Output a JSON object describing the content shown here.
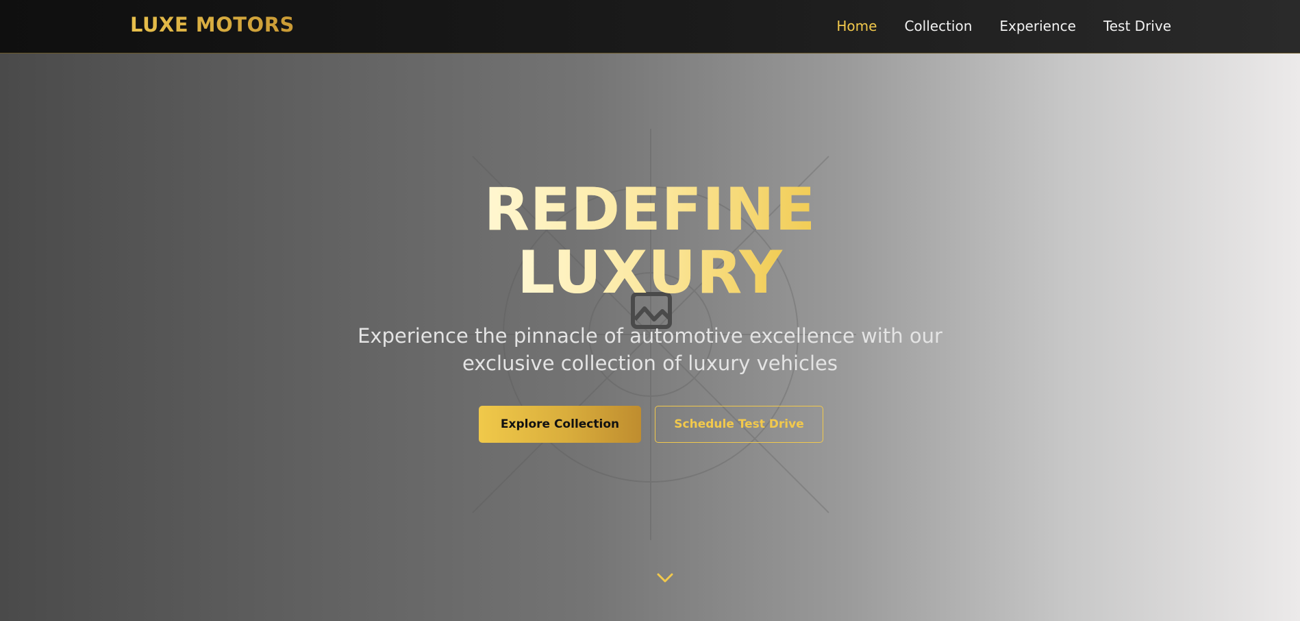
{
  "brand": {
    "name": "LUXE MOTORS"
  },
  "nav": {
    "items": [
      {
        "label": "Home",
        "active": true
      },
      {
        "label": "Collection",
        "active": false
      },
      {
        "label": "Experience",
        "active": false
      },
      {
        "label": "Test Drive",
        "active": false
      }
    ]
  },
  "hero": {
    "headline_line1": "REDEFINE",
    "headline_line2": "LUXURY",
    "subtitle_line1": "Experience the pinnacle of automotive excellence with our",
    "subtitle_line2": "exclusive collection of luxury vehicles",
    "primary_button": "Explore Collection",
    "secondary_button": "Schedule Test Drive",
    "background_image_icon": "image-placeholder-icon",
    "scroll_icon": "chevron-down-icon"
  },
  "colors": {
    "accent_gold": "#f2c94c",
    "nav_background": "#151515",
    "nav_text": "#f2f2f2"
  }
}
